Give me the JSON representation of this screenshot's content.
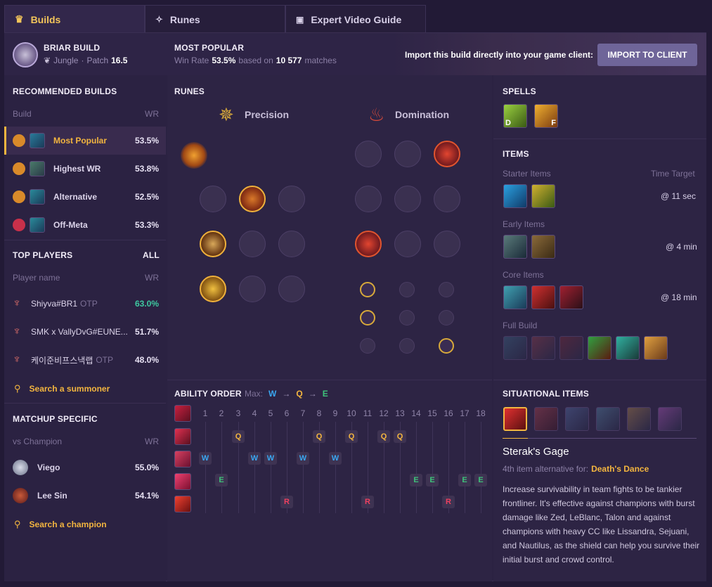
{
  "tabs": [
    {
      "label": "Builds"
    },
    {
      "label": "Runes"
    },
    {
      "label": "Expert Video Guide"
    }
  ],
  "header": {
    "title": "BRIAR BUILD",
    "role": "Jungle",
    "patch_label": "Patch",
    "patch": "16.5",
    "popular_title": "MOST POPULAR",
    "winrate_prefix": "Win Rate",
    "winrate": "53.5%",
    "based_on": "based on",
    "matches": "10 577",
    "matches_suffix": "matches",
    "import_text": "Import this build directly into your game client:",
    "import_button": "IMPORT TO CLIENT"
  },
  "recommended": {
    "title": "RECOMMENDED BUILDS",
    "col_build": "Build",
    "col_wr": "WR",
    "items": [
      {
        "label": "Most Popular",
        "wr": "53.5%"
      },
      {
        "label": "Highest WR",
        "wr": "53.8%"
      },
      {
        "label": "Alternative",
        "wr": "52.5%"
      },
      {
        "label": "Off-Meta",
        "wr": "53.3%"
      }
    ]
  },
  "top_players": {
    "title": "TOP PLAYERS",
    "all": "ALL",
    "col_name": "Player name",
    "col_wr": "WR",
    "players": [
      {
        "name": "Shiyva#BR1",
        "tag": "OTP",
        "wr": "63.0%"
      },
      {
        "name": "SMK x VallyDvG#EUNE...",
        "tag": "",
        "wr": "51.7%"
      },
      {
        "name": "케이준비프스낵랩",
        "tag": "OTP",
        "wr": "48.0%"
      }
    ],
    "search": "Search a summoner"
  },
  "matchup": {
    "title": "MATCHUP SPECIFIC",
    "col_vs": "vs Champion",
    "col_wr": "WR",
    "items": [
      {
        "name": "Viego",
        "wr": "55.0%"
      },
      {
        "name": "Lee Sin",
        "wr": "54.1%"
      }
    ],
    "search": "Search a champion"
  },
  "runes": {
    "title": "RUNES",
    "primary": "Precision",
    "secondary": "Domination"
  },
  "ability": {
    "title": "ABILITY ORDER",
    "max_label": "Max:",
    "max1": "W",
    "max2": "Q",
    "max3": "E",
    "arrow": "→",
    "levels": [
      "1",
      "2",
      "3",
      "4",
      "5",
      "6",
      "7",
      "8",
      "9",
      "10",
      "11",
      "12",
      "13",
      "14",
      "15",
      "16",
      "17",
      "18"
    ],
    "q": "Q",
    "w": "W",
    "e": "E",
    "r": "R"
  },
  "spells": {
    "title": "SPELLS",
    "keys": [
      "D",
      "F"
    ]
  },
  "items": {
    "title": "ITEMS",
    "starter": "Starter Items",
    "time_target": "Time Target",
    "starter_time": "@ 11 sec",
    "early": "Early Items",
    "early_time": "@ 4 min",
    "core": "Core Items",
    "core_time": "@ 18 min",
    "full": "Full Build"
  },
  "situational": {
    "title": "SITUATIONAL ITEMS",
    "item_name": "Sterak's Gage",
    "alt_for": "4th item alternative for:",
    "alt_item": "Death's Dance",
    "desc": "Increase survivability in team fights to be tankier frontliner. It's effective against champions with burst damage like Zed, LeBlanc, Talon and against champions with heavy CC like Lissandra, Sejuani, and Nautilus, as the shield can help you survive their initial burst and crowd control."
  },
  "colors": {
    "accent": "#f3b53f",
    "q": "#f3b53f",
    "w": "#3aa6f0",
    "e": "#3ec27a",
    "r": "#ef4060",
    "positive": "#3ec9a0"
  }
}
